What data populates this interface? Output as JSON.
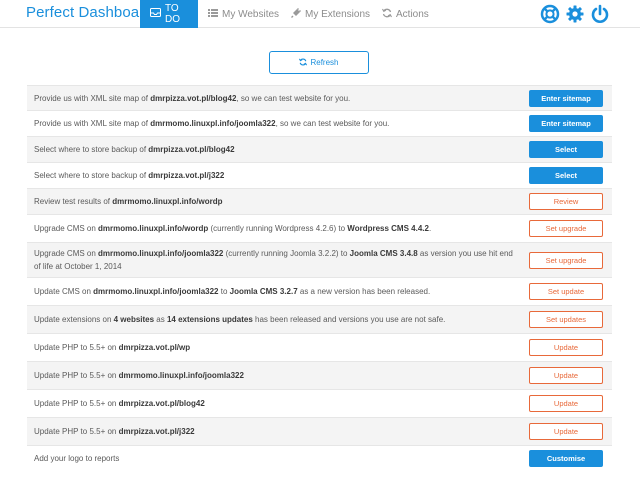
{
  "app": {
    "title": "Perfect Dashboard",
    "accent": "#1a8fdc",
    "warning": "#e8693a"
  },
  "nav": {
    "tabs": [
      {
        "label": "TO DO",
        "icon": "inbox-icon",
        "active": true
      },
      {
        "label": "My Websites",
        "icon": "list-icon",
        "active": false
      },
      {
        "label": "My Extensions",
        "icon": "plug-icon",
        "active": false
      },
      {
        "label": "Actions",
        "icon": "sync-icon",
        "active": false
      }
    ],
    "right_icons": [
      "help-icon",
      "gear-icon",
      "power-icon"
    ]
  },
  "toolbar": {
    "refresh_label": "Refresh"
  },
  "tasks": [
    {
      "parts": [
        [
          "Provide us with XML site map of ",
          false
        ],
        [
          "dmrpizza.vot.pl/blog42",
          true
        ],
        [
          ", so we can test website for you.",
          false
        ]
      ],
      "action": "Enter sitemap",
      "style": "blue"
    },
    {
      "parts": [
        [
          "Provide us with XML site map of ",
          false
        ],
        [
          "dmrmomo.linuxpl.info/joomla322",
          true
        ],
        [
          ", so we can test website for you.",
          false
        ]
      ],
      "action": "Enter sitemap",
      "style": "blue"
    },
    {
      "parts": [
        [
          "Select where to store backup of ",
          false
        ],
        [
          "dmrpizza.vot.pl/blog42",
          true
        ]
      ],
      "action": "Select",
      "style": "blue"
    },
    {
      "parts": [
        [
          "Select where to store backup of ",
          false
        ],
        [
          "dmrpizza.vot.pl/j322",
          true
        ]
      ],
      "action": "Select",
      "style": "blue"
    },
    {
      "parts": [
        [
          "Review test results of ",
          false
        ],
        [
          "dmrmomo.linuxpl.info/wordp",
          true
        ]
      ],
      "action": "Review",
      "style": "orange"
    },
    {
      "parts": [
        [
          "Upgrade CMS on ",
          false
        ],
        [
          "dmrmomo.linuxpl.info/wordp",
          true
        ],
        [
          " (currently running Wordpress 4.2.6) to ",
          false
        ],
        [
          "Wordpress CMS 4.4.2",
          true
        ],
        [
          ".",
          false
        ]
      ],
      "action": "Set upgrade",
      "style": "orange"
    },
    {
      "parts": [
        [
          "Upgrade CMS on ",
          false
        ],
        [
          "dmrmomo.linuxpl.info/joomla322",
          true
        ],
        [
          " (currently running Joomla 3.2.2) to ",
          false
        ],
        [
          "Joomla CMS 3.4.8",
          true
        ],
        [
          " as version you use hit end of life at October 1, 2014",
          false
        ]
      ],
      "action": "Set upgrade",
      "style": "orange"
    },
    {
      "parts": [
        [
          "Update CMS on ",
          false
        ],
        [
          "dmrmomo.linuxpl.info/joomla322",
          true
        ],
        [
          " to ",
          false
        ],
        [
          "Joomla CMS 3.2.7",
          true
        ],
        [
          " as a new version has been released.",
          false
        ]
      ],
      "action": "Set update",
      "style": "orange"
    },
    {
      "parts": [
        [
          "Update extensions on ",
          false
        ],
        [
          "4 websites",
          true
        ],
        [
          " as ",
          false
        ],
        [
          "14 extensions updates",
          true
        ],
        [
          " has been released and versions you use are not safe.",
          false
        ]
      ],
      "action": "Set updates",
      "style": "orange"
    },
    {
      "parts": [
        [
          "Update PHP to 5.5+ on ",
          false
        ],
        [
          "dmrpizza.vot.pl/wp",
          true
        ]
      ],
      "action": "Update",
      "style": "orange"
    },
    {
      "parts": [
        [
          "Update PHP to 5.5+ on ",
          false
        ],
        [
          "dmrmomo.linuxpl.info/joomla322",
          true
        ]
      ],
      "action": "Update",
      "style": "orange"
    },
    {
      "parts": [
        [
          "Update PHP to 5.5+ on ",
          false
        ],
        [
          "dmrpizza.vot.pl/blog42",
          true
        ]
      ],
      "action": "Update",
      "style": "orange"
    },
    {
      "parts": [
        [
          "Update PHP to 5.5+ on ",
          false
        ],
        [
          "dmrpizza.vot.pl/j322",
          true
        ]
      ],
      "action": "Update",
      "style": "orange"
    },
    {
      "parts": [
        [
          "Add your logo to reports",
          false
        ]
      ],
      "action": "Customise",
      "style": "blue"
    }
  ]
}
